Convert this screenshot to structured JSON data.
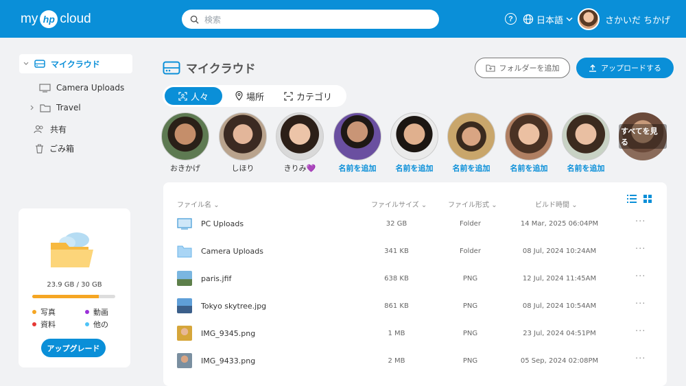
{
  "header": {
    "logo_left": "my",
    "logo_mark": "hp",
    "logo_right": "cloud",
    "search_placeholder": "検索",
    "help_glyph": "?",
    "language": "日本語",
    "user_name": "さかいだ ちかげ"
  },
  "sidebar": {
    "items": [
      {
        "label": "マイクラウド",
        "icon": "drive-icon"
      },
      {
        "label": "Camera Uploads",
        "icon": "monitor-icon"
      },
      {
        "label": "Travel",
        "icon": "folder-icon"
      },
      {
        "label": "共有",
        "icon": "people-icon"
      },
      {
        "label": "ごみ箱",
        "icon": "trash-icon"
      }
    ],
    "storage": {
      "used_text": "23.9 GB / 30 GB",
      "used_fraction": 0.8,
      "legend": [
        {
          "label": "写真",
          "color": "#f5a623"
        },
        {
          "label": "動画",
          "color": "#9b30d9"
        },
        {
          "label": "資料",
          "color": "#e53935"
        },
        {
          "label": "他の",
          "color": "#4fc3f7"
        }
      ],
      "upgrade_label": "アップグレード"
    }
  },
  "main": {
    "title": "マイクラウド",
    "add_folder_label": "フォルダーを追加",
    "upload_label": "アップロードする",
    "tabs": [
      {
        "label": "人々",
        "icon": "face-scan-icon",
        "active": true
      },
      {
        "label": "場所",
        "icon": "pin-icon",
        "active": false
      },
      {
        "label": "カテゴリ",
        "icon": "category-icon",
        "active": false
      }
    ],
    "people": [
      {
        "name": "おきかげ",
        "named": true
      },
      {
        "name": "しほり",
        "named": true
      },
      {
        "name": "きりみ💜",
        "named": true
      },
      {
        "name": "名前を追加",
        "named": false
      },
      {
        "name": "名前を追加",
        "named": false
      },
      {
        "name": "名前を追加",
        "named": false
      },
      {
        "name": "名前を追加",
        "named": false
      },
      {
        "name": "名前を追加",
        "named": false
      }
    ],
    "see_all_label": "すべてを見る",
    "table": {
      "columns": [
        "ファイル名",
        "ファイルサイズ",
        "ファイル形式",
        "ビルド時間"
      ],
      "sort_glyph": "⌄",
      "more_glyph": "···",
      "rows": [
        {
          "name": "PC Uploads",
          "size": "32 GB",
          "type": "Folder",
          "date": "14 Mar, 2025 06:04PM",
          "icon": "monitor-icon"
        },
        {
          "name": "Camera Uploads",
          "size": "341 KB",
          "type": "Folder",
          "date": "08 Jul, 2024 10:24AM",
          "icon": "folder-icon"
        },
        {
          "name": "paris.jfif",
          "size": "638 KB",
          "type": "PNG",
          "date": "12 Jul, 2024 11:45AM",
          "icon": "image-thumbnail-icon"
        },
        {
          "name": "Tokyo skytree.jpg",
          "size": "861 KB",
          "type": "PNG",
          "date": "08 Jul, 2024 10:54AM",
          "icon": "image-thumbnail-icon"
        },
        {
          "name": "IMG_9345.png",
          "size": "1 MB",
          "type": "PNG",
          "date": "23 Jul, 2024 04:51PM",
          "icon": "image-thumbnail-icon"
        },
        {
          "name": "IMG_9433.png",
          "size": "2 MB",
          "type": "PNG",
          "date": "05 Sep, 2024 02:08PM",
          "icon": "image-thumbnail-icon"
        }
      ]
    }
  }
}
